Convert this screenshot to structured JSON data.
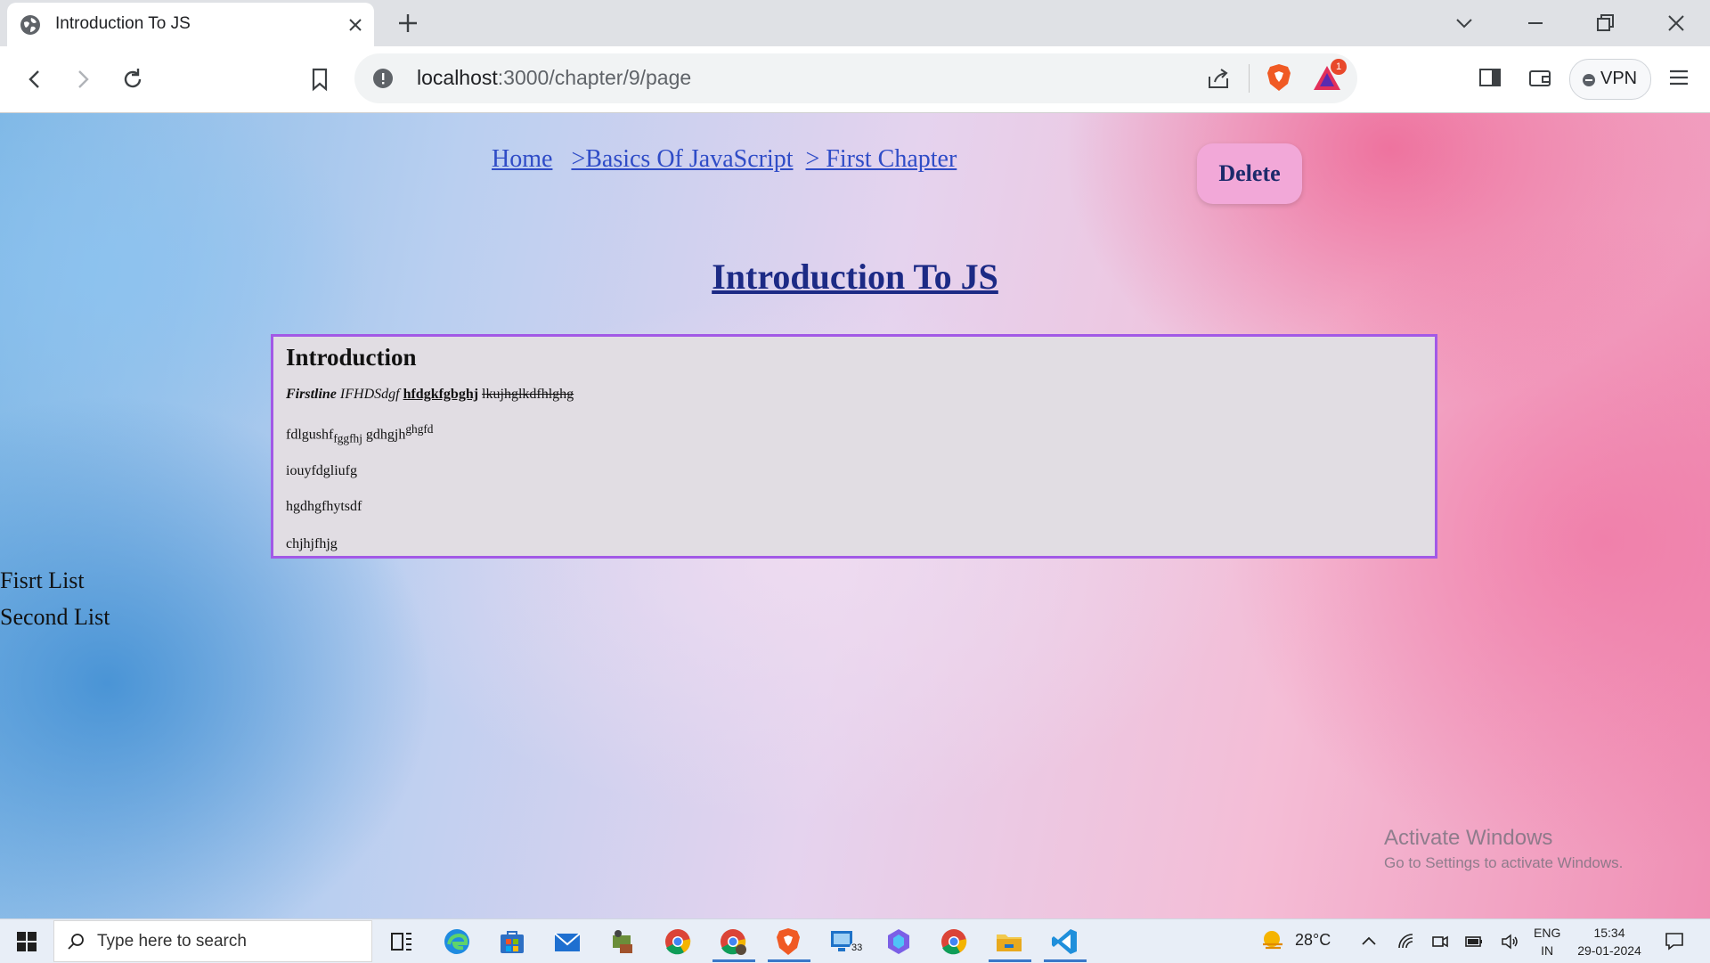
{
  "browser": {
    "tab_title": "Introduction To JS",
    "url_host": "localhost",
    "url_path": ":3000/chapter/9/page",
    "rewards_badge": "1",
    "vpn_label": "VPN"
  },
  "breadcrumb": {
    "home": "Home",
    "course": ">Basics Of JavaScript",
    "chapter": "> First Chapter"
  },
  "delete_label": "Delete",
  "page_title": "Introduction To JS",
  "content": {
    "heading": "Introduction",
    "line1_bold_italic": "Firstline",
    "line1_italic": "IFHDSdgf",
    "line1_bold_underline": "hfdgkfgbghj",
    "line1_strike": "lkujhglkdfhlghg",
    "line2_text": "fdlgushf",
    "line2_sub": "fggfhj",
    "line2_text2": "gdhgjh",
    "line2_sup": "ghgfd",
    "line3": "iouyfdgliufg",
    "line4": "hgdhgfhytsdf",
    "line5": "chjhjfhjg"
  },
  "list": [
    "Fisrt List",
    "Second List"
  ],
  "watermark": {
    "title": "Activate Windows",
    "subtitle": "Go to Settings to activate Windows."
  },
  "taskbar": {
    "search_placeholder": "Type here to search",
    "temperature": "28°C",
    "lang_1": "ENG",
    "lang_2": "IN",
    "time": "15:34",
    "date": "29-01-2024",
    "mail_badge": "33"
  }
}
